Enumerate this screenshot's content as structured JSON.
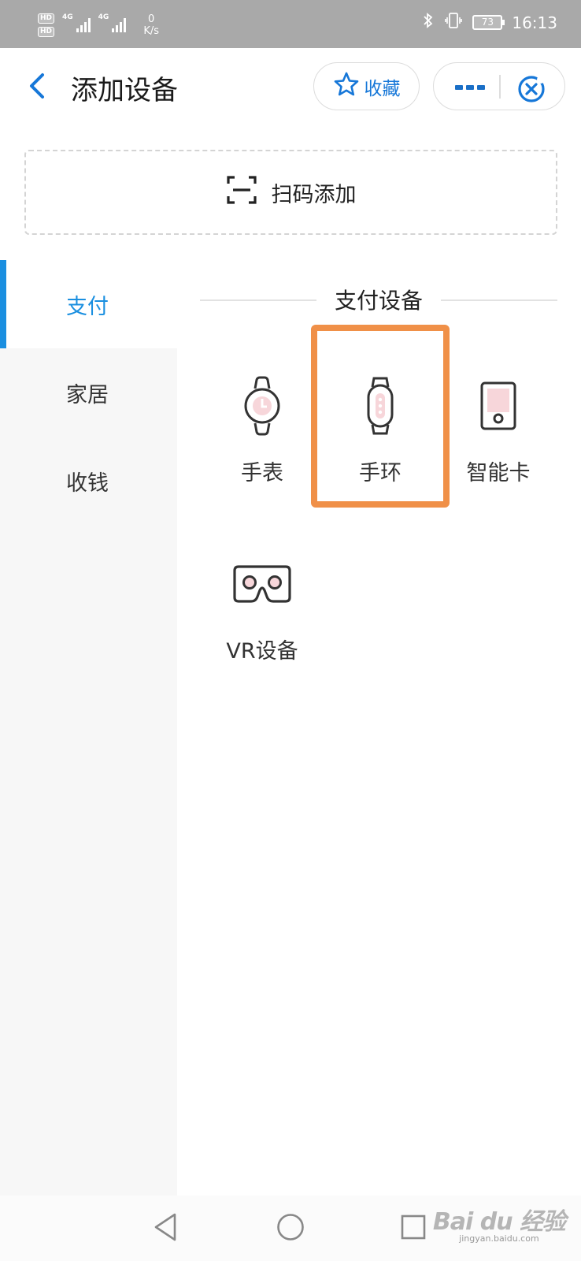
{
  "status_bar": {
    "hd1": "HD",
    "hd2": "HD",
    "sig1_label": "4G",
    "sig2_label": "4G",
    "net_speed_value": "0",
    "net_speed_unit": "K/s",
    "battery": "73",
    "time": "16:13"
  },
  "header": {
    "title": "添加设备",
    "favorite_label": "收藏"
  },
  "scan": {
    "label": "扫码添加"
  },
  "sidebar": {
    "items": [
      {
        "label": "支付",
        "active": true
      },
      {
        "label": "家居",
        "active": false
      },
      {
        "label": "收钱",
        "active": false
      }
    ]
  },
  "section": {
    "title": "支付设备",
    "devices": [
      {
        "label": "手表",
        "icon": "watch-icon"
      },
      {
        "label": "手环",
        "icon": "band-icon",
        "highlighted": true
      },
      {
        "label": "智能卡",
        "icon": "smart-card-icon"
      },
      {
        "label": "VR设备",
        "icon": "vr-icon"
      }
    ]
  },
  "watermark": {
    "brand": "Bai du 经验",
    "site": "jingyan.baidu.com"
  },
  "colors": {
    "accent": "#1a8fe0",
    "highlight": "#f09048",
    "pink": "#f5c6cb"
  }
}
